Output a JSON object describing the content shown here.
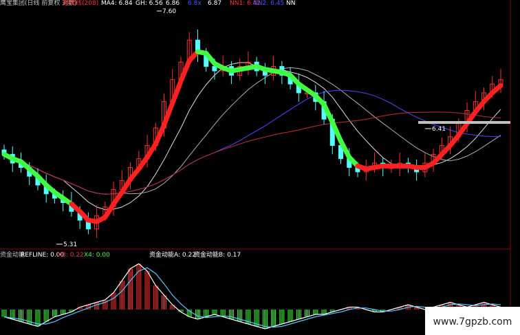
{
  "main_panel": {
    "title": "鹰宝集团(日线 前复权 对数)",
    "indicator": "超卖线(208)",
    "ma4": "MA4: 6.84",
    "gh": "GH: 6.56",
    "v6_86": "6.86",
    "v6_8x": "6.8x",
    "v6_87": "6.87",
    "nn1": "NN1: 6.42",
    "nn2": "NN2: 6.45",
    "nn": "NN",
    "high_label": "7.60",
    "low_label": "5.31",
    "right_label": "6.41"
  },
  "sub_panel": {
    "name": "资金动能",
    "refline": "REFLINE: 0.00",
    "x3": "X3: 0.22",
    "x4": "X4: 0.00",
    "a": "资金动能A: 0.22",
    "b": "资金动能B: 0.17"
  },
  "watermark": "www.7gpzb.com",
  "colors": {
    "up": "#ff3030",
    "down": "#54ffff",
    "ribbon_up": "#ff2020",
    "ribbon_down": "#40ff40",
    "bg": "#000000"
  },
  "chart_data": [
    {
      "type": "candlestick",
      "price_range": [
        5.2,
        7.8
      ],
      "closes": [
        6.2,
        6.1,
        6.05,
        5.95,
        5.85,
        5.75,
        5.7,
        5.65,
        5.55,
        5.45,
        5.35,
        5.5,
        5.6,
        5.8,
        5.9,
        6.05,
        6.15,
        6.3,
        6.5,
        6.8,
        7.05,
        7.25,
        7.5,
        7.35,
        7.2,
        7.15,
        7.2,
        7.1,
        7.2,
        7.25,
        7.15,
        7.1,
        7.2,
        7.1,
        7.0,
        6.9,
        6.9,
        6.8,
        6.6,
        6.3,
        6.15,
        6.05,
        6.0,
        6.05,
        6.1,
        6.05,
        6.05,
        6.1,
        6.05,
        6.0,
        6.1,
        6.2,
        6.3,
        6.4,
        6.55,
        6.7,
        6.8,
        6.9,
        7.0,
        7.05
      ],
      "ribbon_colors": [
        "g",
        "g",
        "g",
        "g",
        "g",
        "g",
        "g",
        "g",
        "r",
        "r",
        "r",
        "r",
        "r",
        "r",
        "r",
        "r",
        "r",
        "r",
        "r",
        "r",
        "r",
        "r",
        "r",
        "g",
        "g",
        "g",
        "g",
        "g",
        "g",
        "g",
        "g",
        "g",
        "g",
        "g",
        "g",
        "g",
        "g",
        "g",
        "g",
        "g",
        "g",
        "g",
        "r",
        "r",
        "r",
        "r",
        "r",
        "r",
        "r",
        "r",
        "r",
        "r",
        "r",
        "r",
        "r",
        "r",
        "r",
        "r",
        "r",
        "r"
      ],
      "annotations": [
        "7.60",
        "5.31",
        "6.41"
      ]
    },
    {
      "type": "bar",
      "name": "资金动能",
      "values": [
        -0.15,
        -0.2,
        -0.25,
        -0.3,
        -0.35,
        -0.25,
        -0.15,
        -0.1,
        -0.05,
        0.05,
        0.1,
        0.15,
        0.2,
        0.35,
        0.6,
        0.85,
        0.95,
        0.8,
        0.5,
        0.3,
        0.1,
        -0.05,
        -0.15,
        -0.2,
        -0.15,
        -0.1,
        -0.15,
        -0.2,
        -0.25,
        -0.3,
        -0.35,
        -0.4,
        -0.35,
        -0.3,
        -0.25,
        -0.2,
        -0.15,
        -0.1,
        -0.1,
        -0.05,
        0.0,
        0.05,
        0.05,
        0.0,
        -0.05,
        -0.05,
        0.0,
        0.05,
        0.1,
        0.05,
        0.0,
        0.05,
        0.1,
        0.15,
        0.1,
        0.05,
        0.1,
        0.15,
        0.1,
        0.05
      ],
      "range": [
        -0.5,
        1.0
      ]
    }
  ]
}
